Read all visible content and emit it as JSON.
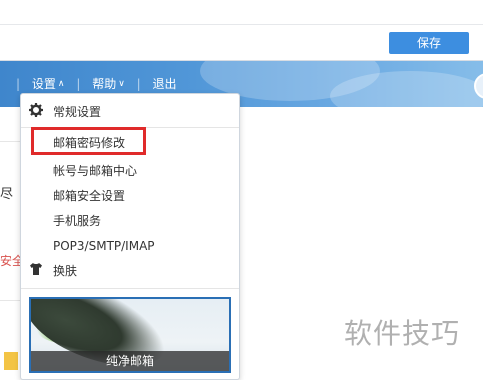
{
  "toolbar": {
    "save_label": "保存"
  },
  "nav": {
    "settings_label": "设置",
    "help_label": "帮助",
    "logout_label": "退出",
    "chevron": "∧",
    "chevron_down": "∨"
  },
  "settings_menu": {
    "general_label": "常规设置",
    "items": [
      {
        "label": "邮箱密码修改"
      },
      {
        "label": "帐号与邮箱中心"
      },
      {
        "label": "邮箱安全设置"
      },
      {
        "label": "手机服务"
      },
      {
        "label": "POP3/SMTP/IMAP"
      }
    ],
    "skin_label": "换肤",
    "skin_thumbnail_caption": "纯净邮箱"
  },
  "background_content": {
    "left_text_fragment": "尽",
    "left_red_fragment": "安全"
  },
  "watermark": {
    "text": "软件技巧"
  },
  "colors": {
    "accent": "#3d8ee0",
    "highlight_border": "#e02a2a",
    "navbar_start": "#3f86cc",
    "navbar_end": "#86bde9"
  },
  "icons": {
    "general": "gear-icon",
    "skin": "tshirt-icon"
  }
}
